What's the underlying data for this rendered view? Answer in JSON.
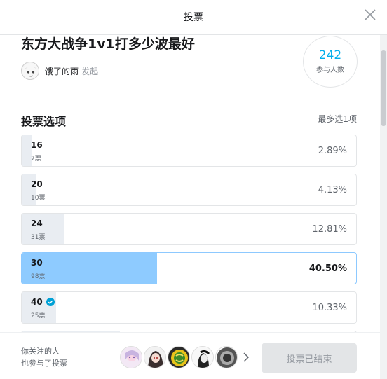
{
  "modal": {
    "title": "投票"
  },
  "vote": {
    "title": "东方大战争1v1打多少波最好",
    "author": "饿了的雨",
    "author_tag": "发起",
    "participants": "242",
    "participants_label": "参与人数"
  },
  "options_section": {
    "title": "投票选项",
    "hint": "最多选1项",
    "items": [
      {
        "label": "16",
        "votes": "7票",
        "percent": "2.89%",
        "fill_fraction": 0.0289,
        "selected": false,
        "verified": false
      },
      {
        "label": "20",
        "votes": "10票",
        "percent": "4.13%",
        "fill_fraction": 0.0413,
        "selected": false,
        "verified": false
      },
      {
        "label": "24",
        "votes": "31票",
        "percent": "12.81%",
        "fill_fraction": 0.1281,
        "selected": false,
        "verified": false
      },
      {
        "label": "30",
        "votes": "98票",
        "percent": "40.50%",
        "fill_fraction": 0.405,
        "selected": true,
        "verified": false
      },
      {
        "label": "40",
        "votes": "25票",
        "percent": "10.33%",
        "fill_fraction": 0.1033,
        "selected": false,
        "verified": true
      }
    ]
  },
  "footer": {
    "follow_line1": "你关注的人",
    "follow_line2": "也参与了投票",
    "end_button": "投票已结束"
  },
  "colors": {
    "accent": "#00aeec",
    "selected_fill": "#8ecbff",
    "bar_fill": "#e9edf2",
    "verified": "#00a1d6"
  },
  "icons": {
    "close": "close-icon",
    "verified": "verified-check-icon",
    "more": "chevron-right-icon"
  }
}
